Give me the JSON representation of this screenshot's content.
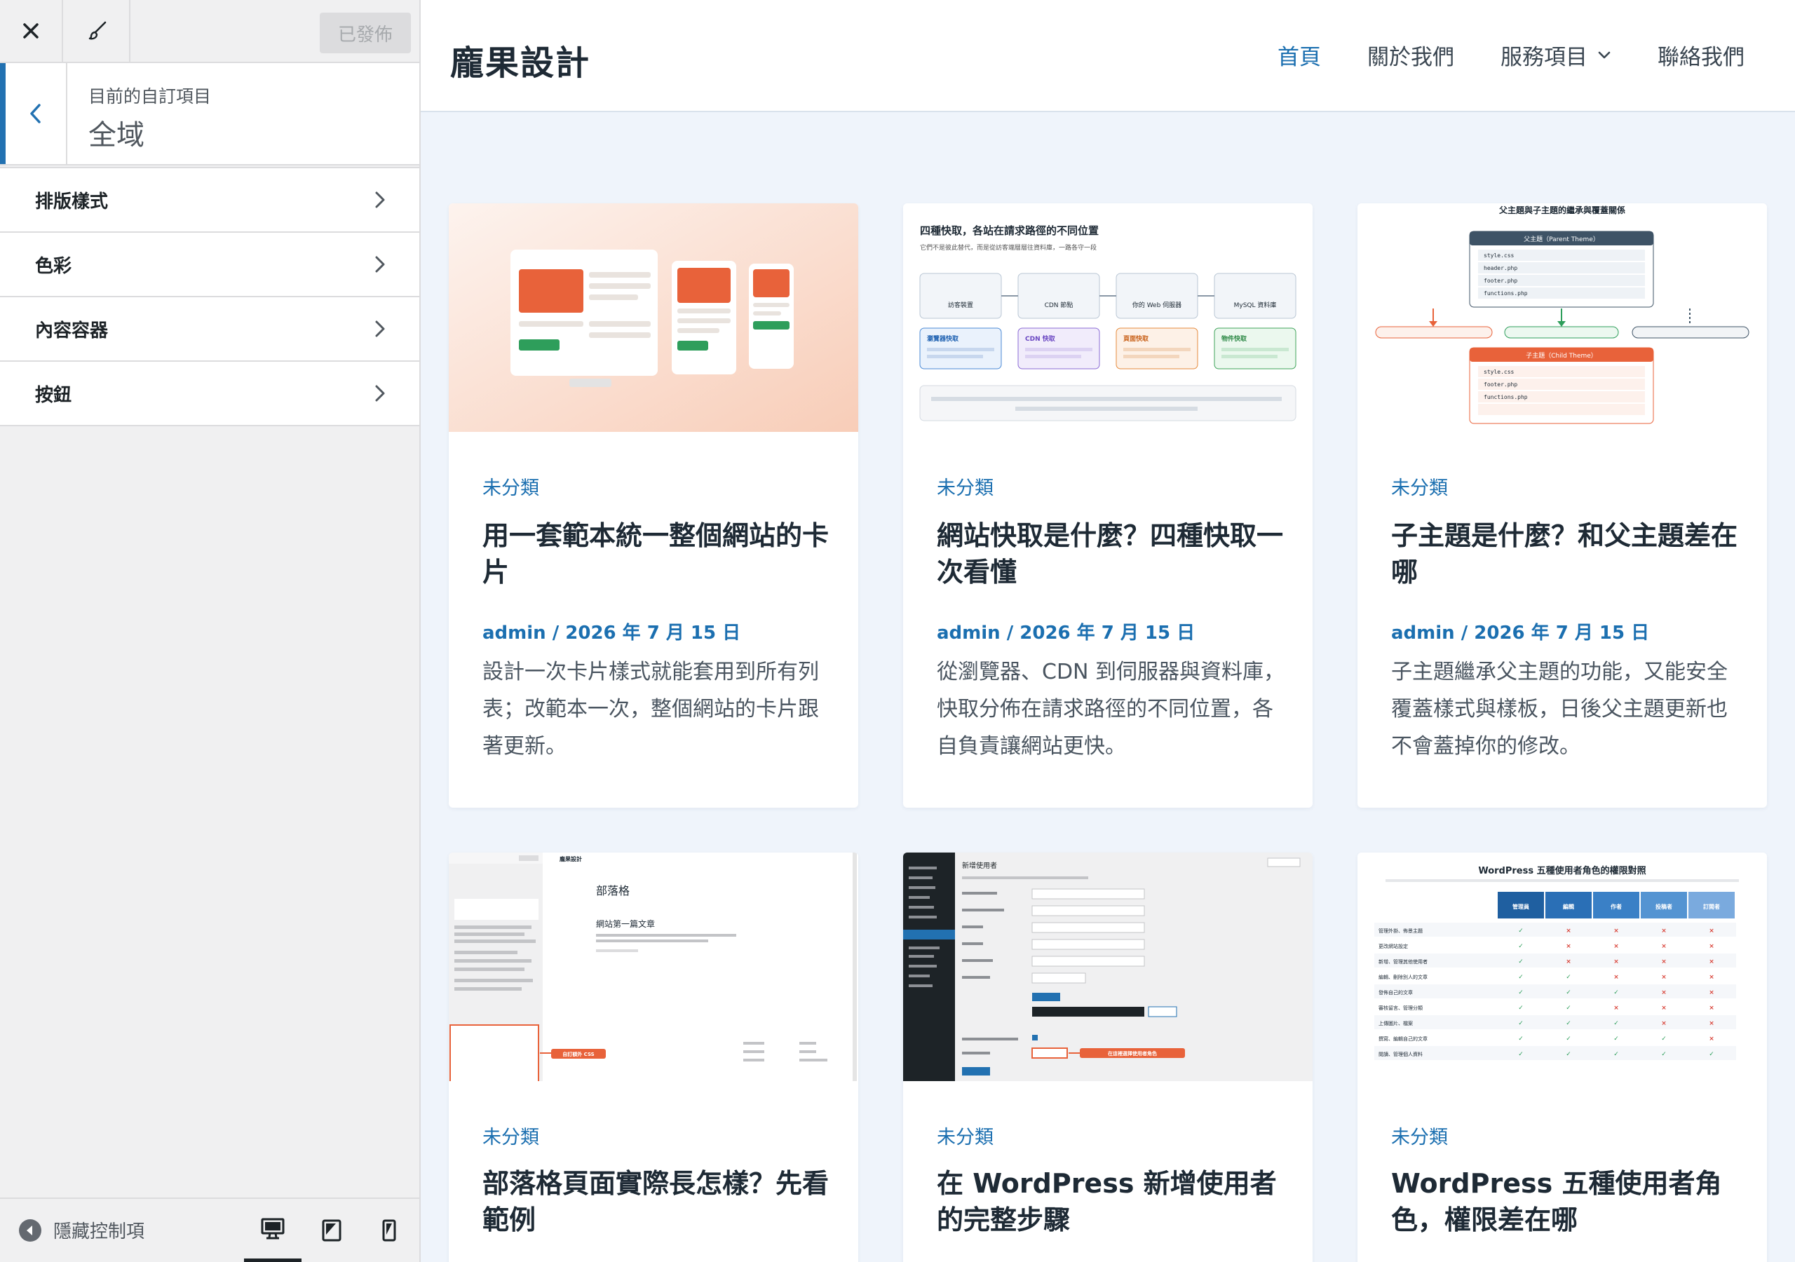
{
  "customizer": {
    "publish_label": "已發佈",
    "section_caption": "目前的自訂項目",
    "section_title": "全域",
    "menu_items": [
      {
        "label": "排版樣式"
      },
      {
        "label": "色彩"
      },
      {
        "label": "內容容器"
      },
      {
        "label": "按鈕"
      }
    ],
    "hide_controls_label": "隱藏控制項"
  },
  "site": {
    "title": "龐果設計",
    "nav": [
      {
        "label": "首頁",
        "active": true
      },
      {
        "label": "關於我們"
      },
      {
        "label": "服務項目",
        "dropdown": true
      },
      {
        "label": "聯絡我們"
      }
    ]
  },
  "posts": [
    {
      "category": "未分類",
      "title": "用一套範本統一整個網站的卡片",
      "meta": "admin / 2026 年 7 月 15 日",
      "excerpt": "設計一次卡片樣式就能套用到所有列表；改範本一次，整個網站的卡片跟著更新。",
      "thumb": "cards"
    },
    {
      "category": "未分類",
      "title": "網站快取是什麼？四種快取一次看懂",
      "meta": "admin / 2026 年 7 月 15 日",
      "excerpt": "從瀏覽器、CDN 到伺服器與資料庫，快取分佈在請求路徑的不同位置，各自負責讓網站更快。",
      "thumb": "cache"
    },
    {
      "category": "未分類",
      "title": "子主題是什麼？和父主題差在哪",
      "meta": "admin / 2026 年 7 月 15 日",
      "excerpt": "子主題繼承父主題的功能，又能安全覆蓋樣式與樣板，日後父主題更新也不會蓋掉你的修改。",
      "thumb": "child"
    },
    {
      "category": "未分類",
      "title": "部落格頁面實際長怎樣？先看範例",
      "thumb": "blog"
    },
    {
      "category": "未分類",
      "title": "在 WordPress 新增使用者的完整步驟",
      "thumb": "users"
    },
    {
      "category": "未分類",
      "title": "WordPress 五種使用者角色，權限差在哪",
      "thumb": "roles"
    }
  ],
  "thumbs": {
    "cache": {
      "heading": "四種快取，各站在請求路徑的不同位置",
      "sub": "它們不是彼此替代，而是從訪客端層層往資料庫，一路各守一段",
      "nodes": [
        "訪客裝置",
        "CDN 節點",
        "你的 Web 伺服器",
        "MySQL 資料庫"
      ],
      "layers": [
        "瀏覽器快取",
        "CDN 快取",
        "頁面快取",
        "物件快取"
      ]
    },
    "child": {
      "heading": "父主題與子主題的繼承與覆蓋關係",
      "parent": "父主題（Parent Theme）",
      "child": "子主題（Child Theme）",
      "parent_files": [
        "style.css",
        "header.php",
        "footer.php",
        "functions.php"
      ],
      "child_files": [
        "style.css",
        "footer.php",
        "functions.php"
      ]
    },
    "blog": {
      "site": "龐果設計",
      "page": "部落格",
      "post": "網站第一篇文章",
      "callout": "自訂額外 CSS"
    },
    "users": {
      "heading": "新增使用者",
      "callout": "在這裡選擇使用者角色"
    },
    "roles": {
      "heading": "WordPress 五種使用者角色的權限對照",
      "cols": [
        "管理員",
        "編輯",
        "作者",
        "投稿者",
        "訂閱者"
      ],
      "rows": [
        "管理外掛、佈景主題",
        "更改網站設定",
        "新增、管理其他使用者",
        "編輯、刪除別人的文章",
        "發佈自己的文章",
        "審核留言、管理分類",
        "上傳圖片、檔案",
        "撰寫、編輯自己的文章",
        "閱讀、管理個人資料"
      ],
      "matrix": [
        [
          1,
          0,
          0,
          0,
          0
        ],
        [
          1,
          0,
          0,
          0,
          0
        ],
        [
          1,
          0,
          0,
          0,
          0
        ],
        [
          1,
          1,
          0,
          0,
          0
        ],
        [
          1,
          1,
          1,
          0,
          0
        ],
        [
          1,
          1,
          0,
          0,
          0
        ],
        [
          1,
          1,
          1,
          0,
          0
        ],
        [
          1,
          1,
          1,
          1,
          0
        ],
        [
          1,
          1,
          1,
          1,
          1
        ]
      ]
    }
  },
  "colors": {
    "accent": "#1b6fb0",
    "wp_blue": "#2271b1",
    "orange": "#e8623a"
  }
}
